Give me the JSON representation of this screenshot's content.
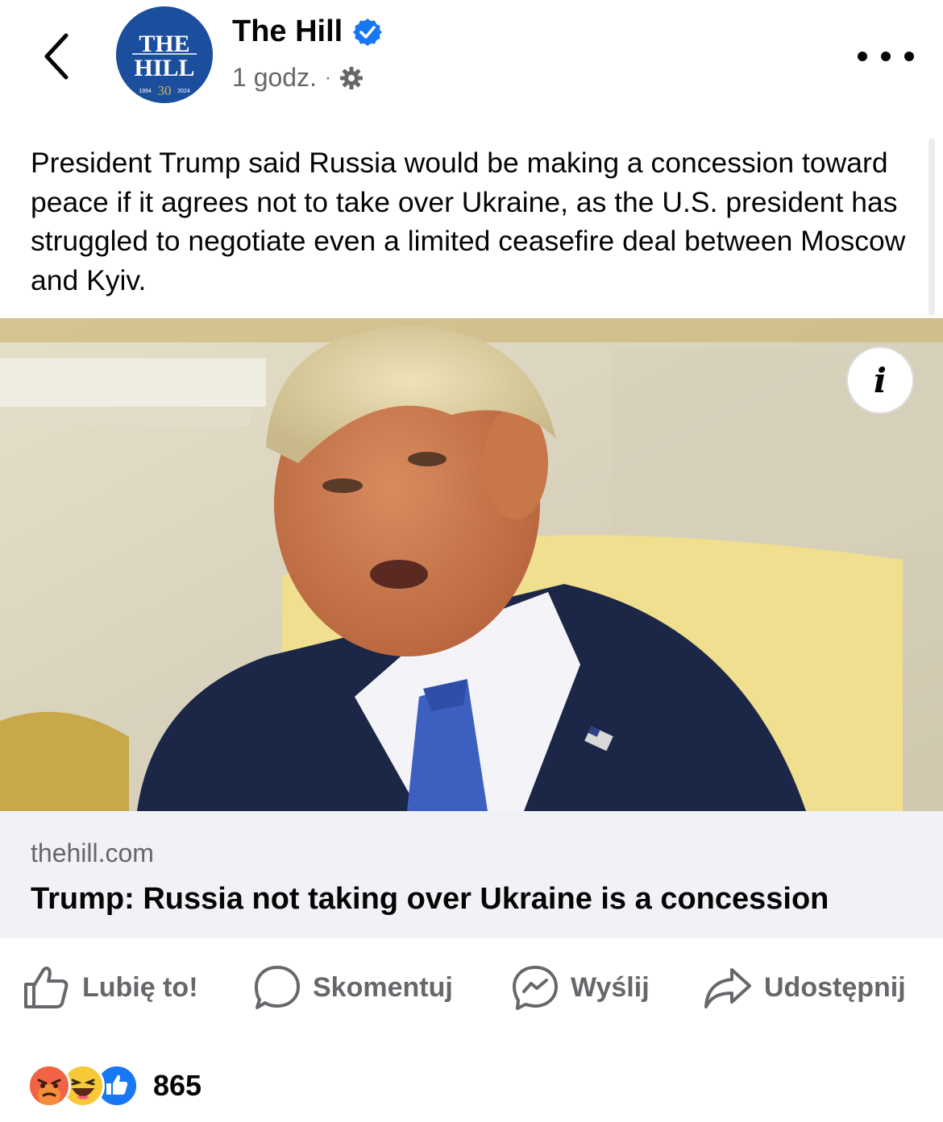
{
  "header": {
    "page_name": "The Hill",
    "time": "1 godz.",
    "separator": "·",
    "avatar": {
      "line1": "THE",
      "line2": "HILL",
      "year_start": "1994",
      "anniversary": "30",
      "year_end": "2024"
    }
  },
  "post": {
    "text": "President Trump said Russia would be making a concession toward peace if it agrees not to take over Ukraine, as the U.S. president has struggled to negotiate even a limited ceasefire deal between Moscow and Kyiv."
  },
  "link": {
    "domain": "thehill.com",
    "title": "Trump: Russia not taking over Ukraine is a concession"
  },
  "actions": {
    "like": "Lubię to!",
    "comment": "Skomentuj",
    "send": "Wyślij",
    "share": "Udostępnij"
  },
  "reactions": {
    "count": "865",
    "types": [
      "angry",
      "haha",
      "like"
    ]
  },
  "colors": {
    "brand_blue": "#1c4e9e",
    "verified_blue": "#1877f2",
    "secondary_text": "#65676b",
    "link_bg": "#f0f2f5"
  }
}
